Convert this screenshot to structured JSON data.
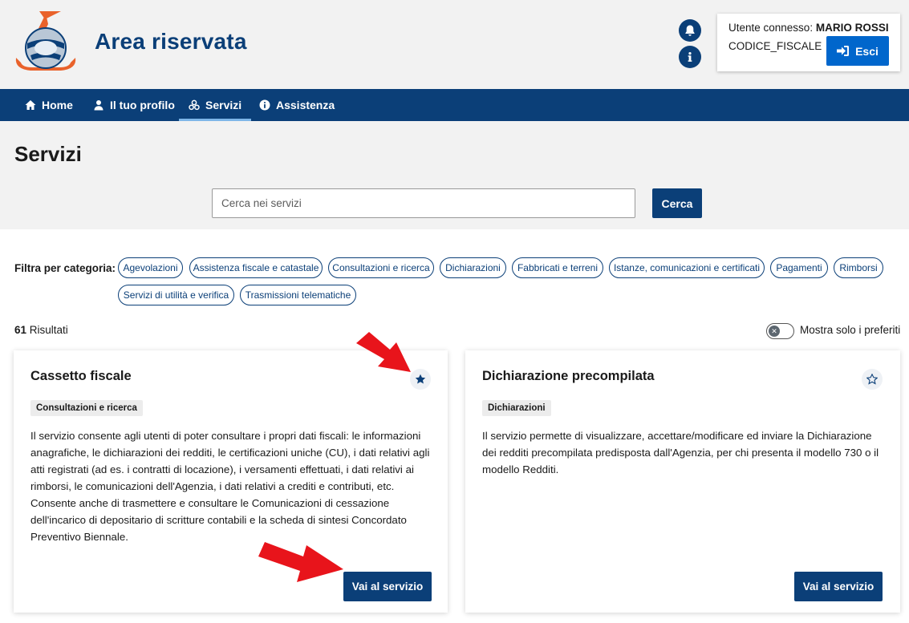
{
  "header": {
    "app_title": "Area riservata",
    "user_prefix": "Utente connesso:",
    "user_name": "MARIO ROSSI",
    "codice_fiscale": "CODICE_FISCALE",
    "logout_label": "Esci"
  },
  "nav": {
    "items": [
      {
        "label": "Home",
        "icon": "home-icon"
      },
      {
        "label": "Il tuo profilo",
        "icon": "user-icon"
      },
      {
        "label": "Servizi",
        "icon": "services-icon"
      },
      {
        "label": "Assistenza",
        "icon": "info-icon"
      }
    ],
    "active": "Servizi"
  },
  "page": {
    "title": "Servizi",
    "search_placeholder": "Cerca nei servizi",
    "search_value": "",
    "search_button": "Cerca"
  },
  "filters": {
    "label": "Filtra per categoria:",
    "chips": [
      "Agevolazioni",
      "Assistenza fiscale e catastale",
      "Consultazioni e ricerca",
      "Dichiarazioni",
      "Fabbricati e terreni",
      "Istanze, comunicazioni e certificati",
      "Pagamenti",
      "Rimborsi",
      "Servizi di utilità e verifica",
      "Trasmissioni telematiche"
    ]
  },
  "results": {
    "count": "61",
    "label": "Risultati",
    "favorites_toggle_label": "Mostra solo i preferiti",
    "favorites_only": false
  },
  "cards": [
    {
      "title": "Cassetto fiscale",
      "tag": "Consultazioni e ricerca",
      "description": "Il servizio consente agli utenti di poter consultare i propri dati fiscali: le informazioni anagrafiche, le dichiarazioni dei redditi, le certificazioni uniche (CU), i dati relativi agli atti registrati (ad es. i contratti di locazione), i versamenti effettuati, i dati relativi ai rimborsi, le comunicazioni dell'Agenzia, i dati relativi a crediti e contributi, etc. Consente anche di trasmettere e consultare le Comunicazioni di cessazione dell'incarico di depositario di scritture contabili e la scheda di sintesi Concordato Preventivo Biennale.",
      "button": "Vai al servizio",
      "favorite": true
    },
    {
      "title": "Dichiarazione precompilata",
      "tag": "Dichiarazioni",
      "description": "Il servizio permette di visualizzare, accettare/modificare ed inviare la Dichiarazione dei redditi precompilata predisposta dall'Agenzia, per chi presenta il modello 730 o il modello Redditi.",
      "button": "Vai al servizio",
      "favorite": false
    }
  ],
  "colors": {
    "primary": "#0b3f78",
    "accent_blue": "#0066cc",
    "logo_orange": "#e9622b",
    "annotation_red": "#e8141b",
    "band_gray": "#f2f2f2"
  }
}
